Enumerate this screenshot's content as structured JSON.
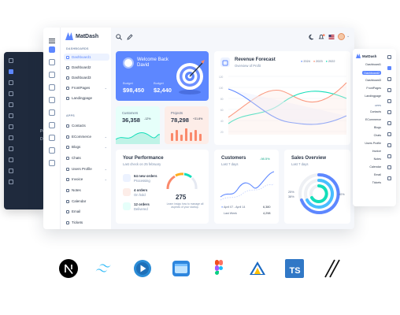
{
  "brand": {
    "name": "MatDash"
  },
  "sidebar": {
    "sections": [
      {
        "title": "DASHBOARDS",
        "items": [
          {
            "label": "Dashboard1",
            "active": true
          },
          {
            "label": "Dashboard2"
          },
          {
            "label": "Dashboard3"
          },
          {
            "label": "FrontPages",
            "has_chevron": true
          },
          {
            "label": "Landingpage"
          }
        ]
      },
      {
        "title": "APPS",
        "items": [
          {
            "label": "Contacts"
          },
          {
            "label": "ECommerce",
            "has_chevron": true
          },
          {
            "label": "Blogs",
            "has_chevron": true
          },
          {
            "label": "Chats"
          },
          {
            "label": "Users Profile",
            "has_chevron": true
          },
          {
            "label": "Invoice",
            "has_chevron": true
          },
          {
            "label": "Notes"
          },
          {
            "label": "Calendar"
          },
          {
            "label": "Email"
          },
          {
            "label": "Tickets"
          }
        ]
      }
    ]
  },
  "welcome": {
    "title_line1": "Welcome Back",
    "title_line2": "David",
    "budget_label": "Budget",
    "budget_value": "$98,450",
    "budget2_label": "Budget",
    "budget2_value": "$2,440"
  },
  "tiles": {
    "customers": {
      "label": "Customers",
      "value": "36,358",
      "change": "-12%"
    },
    "projects": {
      "label": "Projects",
      "value": "78,298",
      "change": "+31.8%"
    }
  },
  "revenue": {
    "title": "Revenue Forecast",
    "subtitle": "Overview of Profit",
    "legend": [
      "2024",
      "2023",
      "2022"
    ]
  },
  "performance": {
    "title": "Your Performance",
    "subtitle": "Last check on 25 february",
    "items": [
      {
        "value": "64 new orders",
        "label": "Processing"
      },
      {
        "value": "4 orders",
        "label": "On hold"
      },
      {
        "value": "12 orders",
        "label": "Delivered"
      }
    ],
    "gauge_value": "275",
    "gauge_text": "Learn insigs how to manage all aspects of your startup."
  },
  "customers_card": {
    "title": "Customers",
    "change": "-98.5%",
    "subtitle": "Last 7 days",
    "rows": [
      {
        "label": "April 07 - April 14",
        "value": "6,380"
      },
      {
        "label": "Last Week",
        "value": "4,298"
      }
    ]
  },
  "sales_card": {
    "title": "Sales Overview",
    "subtitle": "Last 7 days",
    "labels": [
      "25%",
      "38%",
      "40%"
    ]
  },
  "right_panel": {
    "brand": "MatDash",
    "items": [
      "Dashboard1",
      "Dashboard2",
      "Dashboard3",
      "FrontPages",
      "Landingpage"
    ],
    "apps_title": "APPS",
    "apps": [
      "Contacts",
      "ECommerce",
      "Blogs",
      "Chats",
      "Users Profile",
      "Invoice",
      "Notes",
      "Calendar",
      "Email",
      "Tickets"
    ]
  },
  "dark_panel": {
    "snippet_1": "Pe",
    "snippet_2": "D"
  },
  "tech_logos": [
    "nextjs-logo",
    "tailwind-logo",
    "play-logo",
    "window-logo",
    "figma-logo",
    "vuetify-logo",
    "typescript-logo",
    "shadcn-logo"
  ],
  "tech_labels": {
    "typescript": "TS"
  },
  "colors": {
    "primary": "#5d87ff",
    "secondary": "#49beff",
    "success": "#13deb9",
    "warning": "#ffae1f",
    "error": "#fa896b",
    "dark": "#1f2a3d"
  }
}
